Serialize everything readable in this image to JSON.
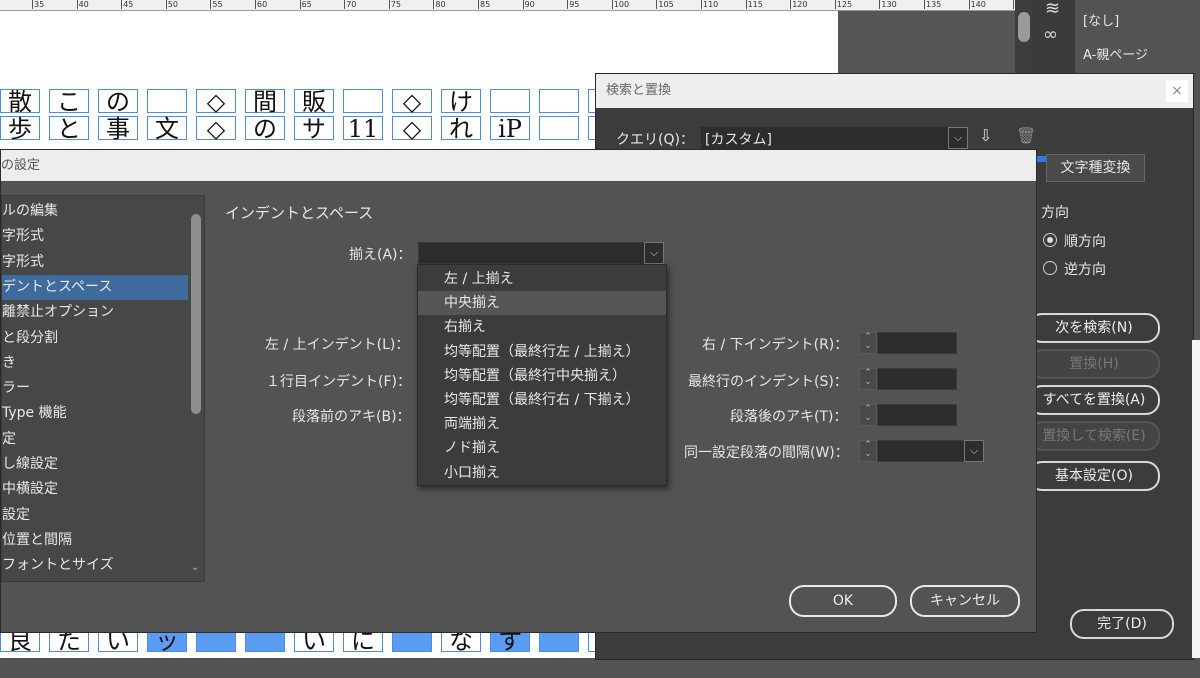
{
  "ruler": {
    "ticks": [
      "35",
      "40",
      "45",
      "50",
      "55",
      "60",
      "65",
      "70",
      "75",
      "80",
      "85",
      "90",
      "95",
      "100",
      "105",
      "110",
      "115",
      "120",
      "125",
      "130",
      "135",
      "140",
      "145"
    ]
  },
  "document": {
    "row1": [
      "散",
      "こ",
      "の",
      "",
      "◇",
      "間",
      "販",
      "",
      "◇",
      "け",
      "",
      "",
      ""
    ],
    "row2": [
      "歩",
      "と",
      "事",
      "文",
      "◇",
      "の",
      "サ",
      "11",
      "◇",
      "れ",
      "iP",
      "",
      ""
    ],
    "row_bottom": [
      "良",
      "た",
      "い",
      "ッ",
      "",
      "",
      "い",
      "に",
      "",
      "な",
      "す",
      "",
      ""
    ]
  },
  "pages_panel": {
    "none_label": "[なし]",
    "parent_label": "A-親ページ"
  },
  "find_replace": {
    "title": "検索と置換",
    "close": "×",
    "query_label": "クエリ(Q)：",
    "query_value": "[カスタム]",
    "tab_char_conversion": "文字種変換",
    "direction_label": "方向",
    "forward_label": "順方向",
    "backward_label": "逆方向",
    "find_next": "次を検索(N)",
    "replace": "置換(H)",
    "replace_all": "すべてを置換(A)",
    "replace_find": "置換して検索(E)",
    "basic_settings": "基本設定(O)",
    "done": "完了(D)"
  },
  "paragraph_style": {
    "title": "の設定",
    "list": [
      "ルの編集",
      "字形式",
      "字形式",
      "デントとスペース",
      "離禁止オプション",
      "と段分割",
      "き",
      "ラー",
      "Type 機能",
      "定",
      "し線設定",
      "中横設定",
      "設定",
      "位置と間隔",
      "フォントとサイズ"
    ],
    "selected_index": 3,
    "section_title": "インデントとスペース",
    "align_label": "揃え(A)：",
    "align_options": [
      "左 / 上揃え",
      "中央揃え",
      "右揃え",
      "均等配置（最終行左 / 上揃え）",
      "均等配置（最終行中央揃え）",
      "均等配置（最終行右 / 下揃え）",
      "両端揃え",
      "ノド揃え",
      "小口揃え"
    ],
    "hover_index": 1,
    "left_indent": "左 / 上インデント(L)：",
    "first_line_indent": "１行目インデント(F)：",
    "space_before": "段落前のアキ(B)：",
    "right_indent": "右 / 下インデント(R)：",
    "last_line_indent": "最終行のインデント(S)：",
    "space_after": "段落後のアキ(T)：",
    "same_style_spacing": "同一設定段落の間隔(W)：",
    "ok": "OK",
    "cancel": "キャンセル"
  }
}
